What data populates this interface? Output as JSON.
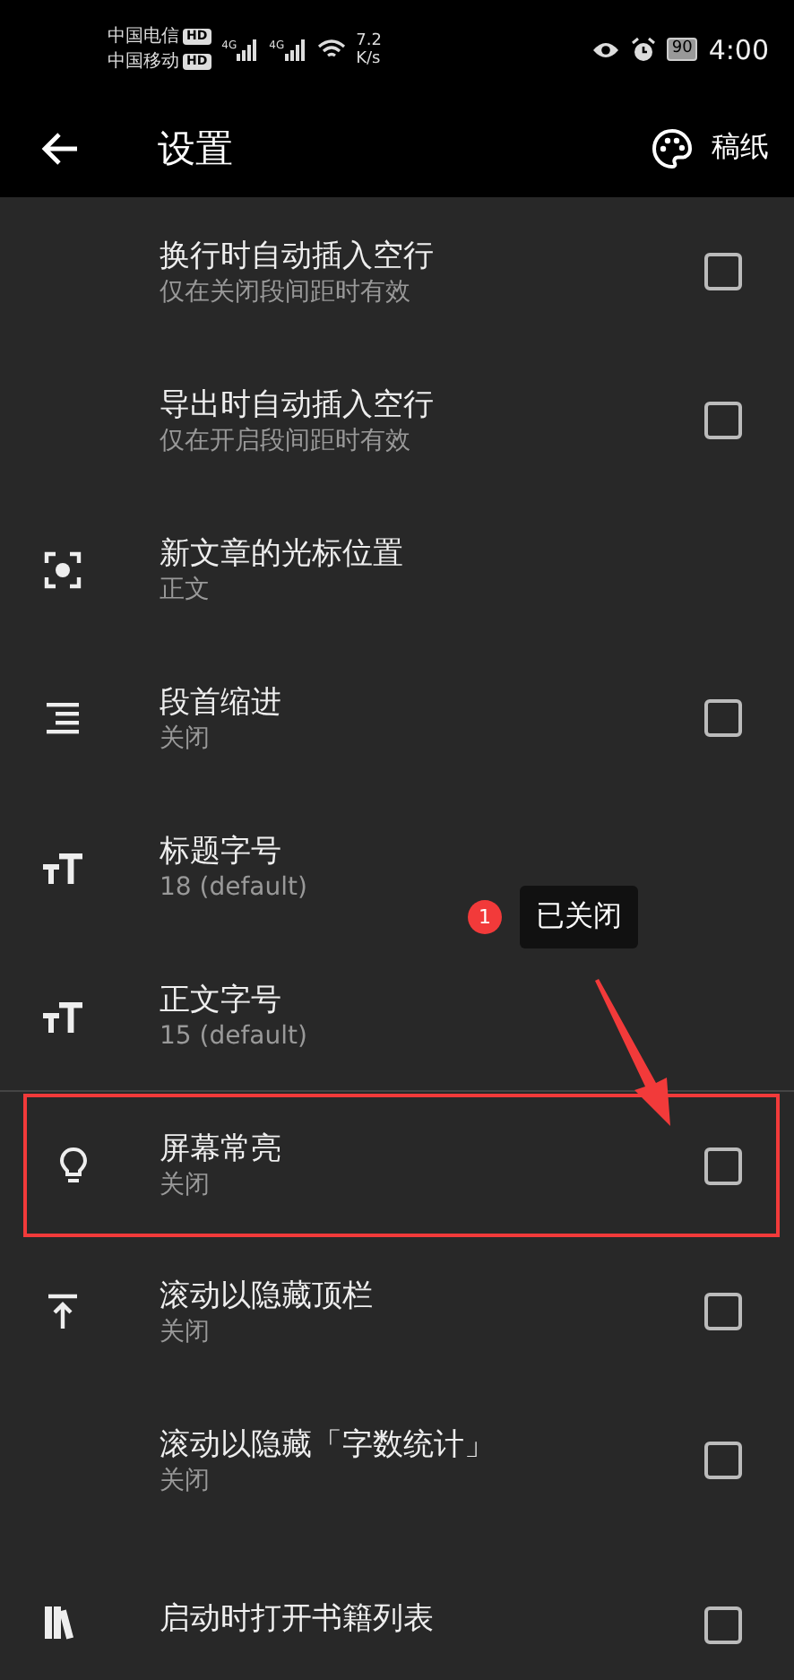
{
  "status_bar": {
    "carriers": [
      {
        "name": "中国电信",
        "badge": "HD"
      },
      {
        "name": "中国移动",
        "badge": "HD"
      }
    ],
    "network_labels": [
      "4G",
      "4G"
    ],
    "speed": "7.2",
    "speed_unit": "K/s",
    "battery": "90",
    "time": "4:00"
  },
  "app_bar": {
    "title": "设置",
    "action": "稿纸"
  },
  "groups": [
    {
      "items": [
        {
          "kind": "checkbox",
          "title": "换行时自动插入空行",
          "subtitle": "仅在关闭段间距时有效",
          "checked": false,
          "highlighted": false
        },
        {
          "kind": "checkbox",
          "title": "导出时自动插入空行",
          "subtitle": "仅在开启段间距时有效",
          "checked": false,
          "highlighted": false
        },
        {
          "kind": "value",
          "title": "新文章的光标位置",
          "subtitle": "正文",
          "highlighted": false
        },
        {
          "kind": "checkbox",
          "title": "段首缩进",
          "subtitle": "关闭",
          "checked": false,
          "highlighted": false
        },
        {
          "kind": "value",
          "title": "标题字号",
          "subtitle": "18 (default)",
          "highlighted": false
        },
        {
          "kind": "value",
          "title": "正文字号",
          "subtitle": "15 (default)",
          "highlighted": false
        }
      ]
    },
    {
      "items": [
        {
          "kind": "checkbox",
          "title": "屏幕常亮",
          "subtitle": "关闭",
          "checked": false,
          "highlighted": true
        },
        {
          "kind": "checkbox",
          "title": "滚动以隐藏顶栏",
          "subtitle": "关闭",
          "checked": false,
          "highlighted": false
        },
        {
          "kind": "checkbox",
          "title": "滚动以隐藏「字数统计」",
          "subtitle": "关闭",
          "checked": false,
          "highlighted": false
        },
        {
          "kind": "checkbox",
          "title": "启动时打开书籍列表",
          "checked": false,
          "highlighted": false
        }
      ]
    }
  ],
  "annotation": {
    "badge": "1",
    "text": "已关闭"
  }
}
